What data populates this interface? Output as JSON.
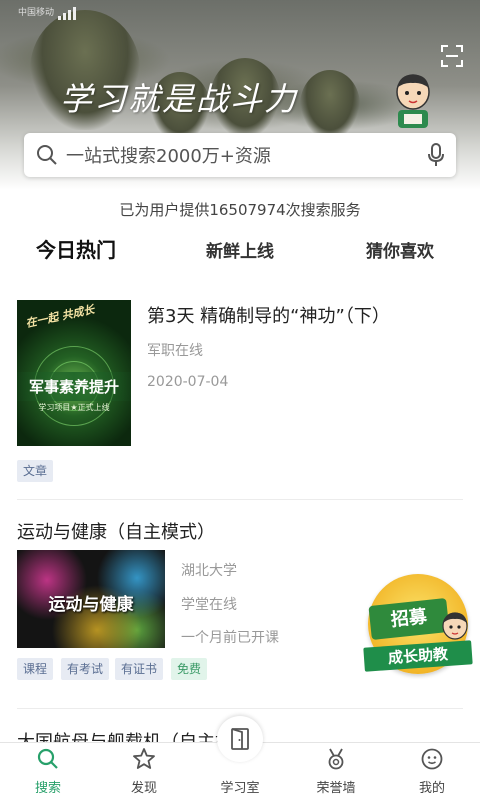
{
  "status_bar": {
    "carrier": "中国移动"
  },
  "hero": {
    "slogan": "学习就是战斗力"
  },
  "search": {
    "placeholder": "一站式搜索2000万+资源"
  },
  "service_line": "已为用户提供16507974次搜索服务",
  "tabs": [
    {
      "label": "今日热门",
      "active": true
    },
    {
      "label": "新鲜上线",
      "active": false
    },
    {
      "label": "猜你喜欢",
      "active": false
    }
  ],
  "feed": [
    {
      "thumb_top": "在一起 共成长",
      "thumb_title": "军事素养提升",
      "thumb_sub": "学习项目★正式上线",
      "title": "第3天 精确制导的“神功”（下）",
      "source": "军职在线",
      "date": "2020-07-04",
      "tags": [
        "文章"
      ]
    },
    {
      "title": "运动与健康（自主模式）",
      "thumb_title": "运动与健康",
      "school": "湖北大学",
      "platform": "学堂在线",
      "status": "一个月前已开课",
      "tags": [
        "课程",
        "有考试",
        "有证书",
        "免费"
      ]
    },
    {
      "title": "大国航母与舰载机（自主模式）"
    }
  ],
  "promo": {
    "board": "招募",
    "ribbon": "成长助教"
  },
  "nav": [
    {
      "label": "搜索",
      "icon": "search-icon",
      "active": true
    },
    {
      "label": "发现",
      "icon": "star-icon",
      "active": false
    },
    {
      "label": "学习室",
      "icon": "door-icon",
      "active": false
    },
    {
      "label": "荣誉墙",
      "icon": "medal-icon",
      "active": false
    },
    {
      "label": "我的",
      "icon": "profile-icon",
      "active": false
    }
  ],
  "colors": {
    "accent": "#27a06a",
    "tag_blue_bg": "#e7ebf3",
    "tag_green_bg": "#e1f4ea"
  }
}
